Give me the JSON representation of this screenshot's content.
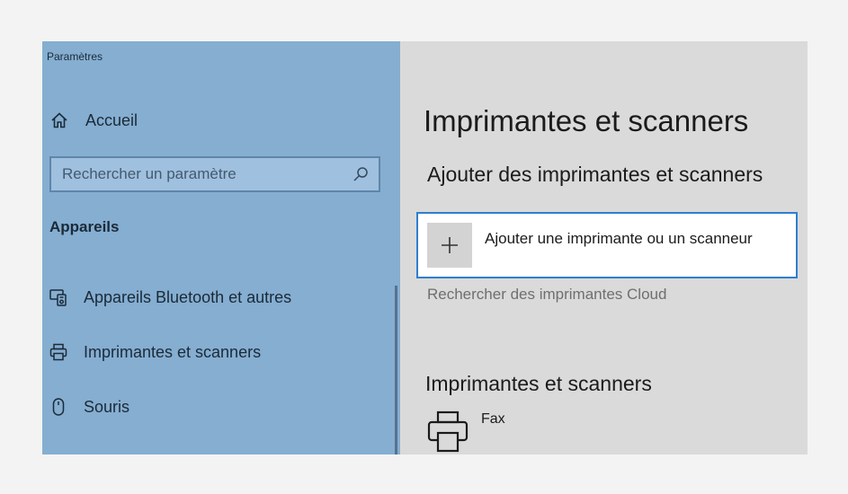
{
  "app": {
    "title": "Paramètres"
  },
  "sidebar": {
    "home_label": "Accueil",
    "search": {
      "placeholder": "Rechercher un paramètre"
    },
    "section_title": "Appareils",
    "items": [
      {
        "label": "Appareils Bluetooth et autres",
        "icon": "bluetooth-devices-icon"
      },
      {
        "label": "Imprimantes et scanners",
        "icon": "printer-icon"
      },
      {
        "label": "Souris",
        "icon": "mouse-icon"
      }
    ]
  },
  "main": {
    "page_title": "Imprimantes et scanners",
    "add_section_title": "Ajouter des imprimantes et scanners",
    "add_button_label": "Ajouter une imprimante ou un scanneur",
    "cloud_link": "Rechercher des imprimantes Cloud",
    "list_title": "Imprimantes et scanners",
    "printers": [
      {
        "name": "Fax",
        "icon": "printer-icon"
      }
    ]
  },
  "colors": {
    "sidebar_bg": "#85aed1",
    "content_bg": "#dadada",
    "accent": "#2d7fd0"
  }
}
